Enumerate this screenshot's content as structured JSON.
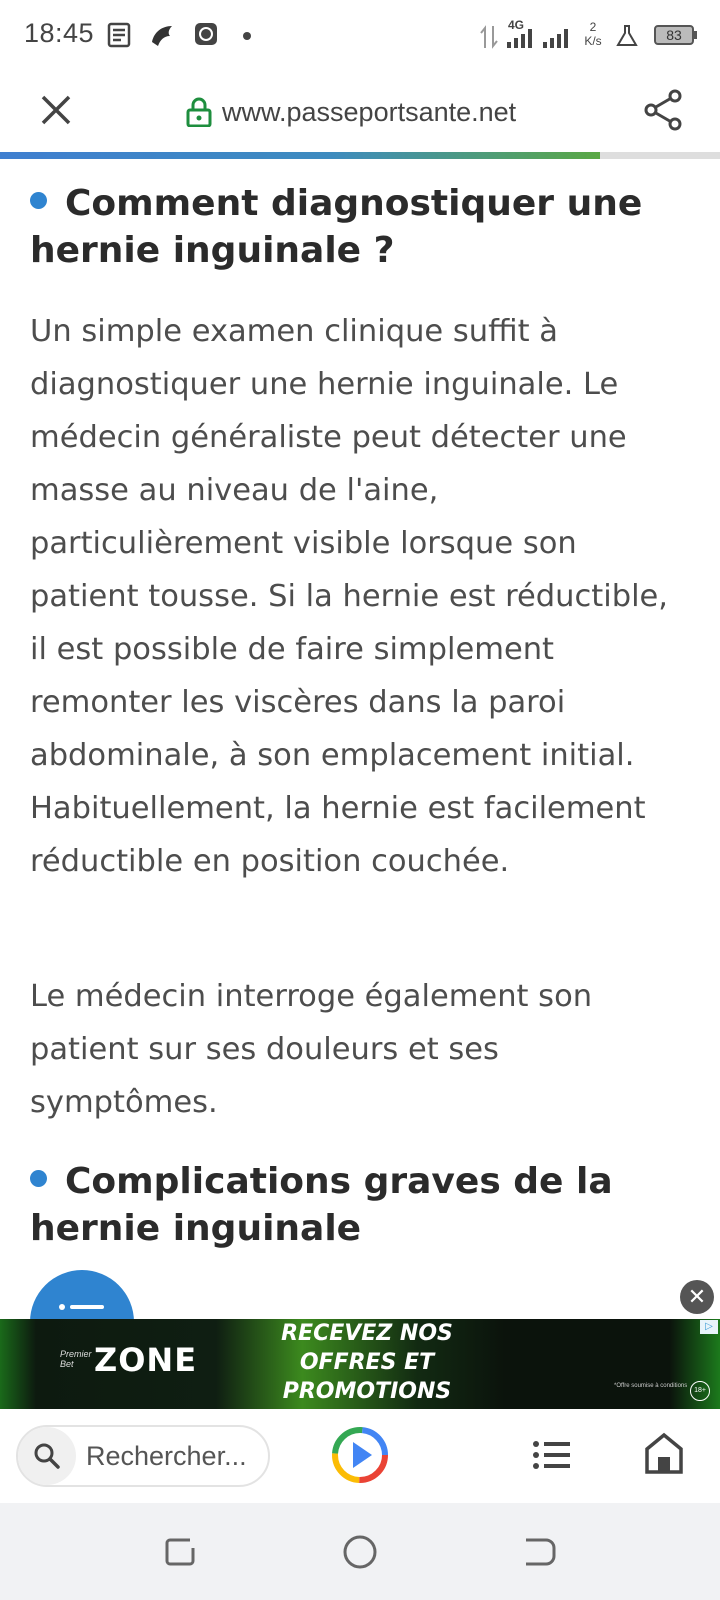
{
  "status_bar": {
    "time": "18:45",
    "network": "4G",
    "speed_value": "2",
    "speed_unit": "K/s",
    "battery": "83",
    "icons": [
      "news-icon",
      "bird-app-icon",
      "bitcoin-app-icon",
      "dot-icon",
      "data-arrows-icon",
      "signal-icon",
      "signal-icon",
      "flask-icon",
      "battery-icon"
    ]
  },
  "browser": {
    "url": "www.passeportsante.net",
    "load_progress": 0.833,
    "icons": [
      "close-icon",
      "lock-icon",
      "share-icon"
    ],
    "colors": {
      "lock": "#1e8e3e",
      "progress_start": "#3f7fd0",
      "progress_end": "#5aa844"
    }
  },
  "article": {
    "heading1": "Comment diagnostiquer une hernie inguinale ?",
    "para1": "Un simple examen clinique suffit à diagnostiquer une hernie inguinale. Le médecin généraliste peut détecter une masse au niveau de l'aine, particulièrement visible lorsque son patient tousse. Si la hernie est réductible, il est possible de faire simplement remonter les viscères dans la paroi abdominale, à son emplacement initial. Habituellement, la hernie est facilement réductible en position couchée.",
    "para2": "Le médecin interroge également son patient sur ses douleurs et ses symptômes.",
    "heading2": "Complications graves de la hernie inguinale",
    "bullet_color": "#2f84d0"
  },
  "ad": {
    "brand_small_line1": "Premier",
    "brand_small_line2": "Bet",
    "brand": "ZONE",
    "headline_line1": "RECEVEZ NOS",
    "headline_line2": "OFFRES ET",
    "headline_line3": "PROMOTIONS",
    "fine_print": "*Offre soumise à conditions",
    "age_badge": "18+",
    "close_icon": "close-circle-icon",
    "adchoices_icon": "adchoices-icon"
  },
  "toolbar": {
    "search_placeholder": "Rechercher...",
    "icons": [
      "search-icon",
      "play-icon",
      "list-icon",
      "home-icon"
    ]
  },
  "navbar": {
    "icons": [
      "recent-apps-icon",
      "home-circle-icon",
      "back-icon"
    ]
  }
}
